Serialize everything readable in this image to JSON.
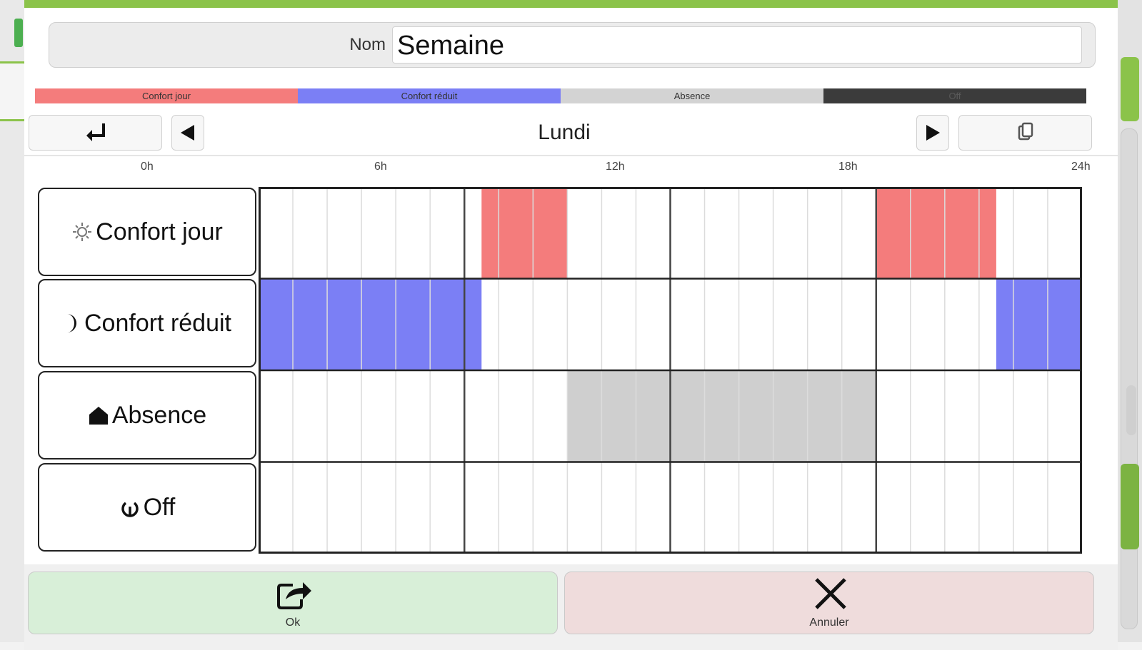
{
  "form": {
    "name_label": "Nom",
    "name_value": "Semaine"
  },
  "legend": [
    {
      "label": "Confort jour",
      "color": "#f47c7c"
    },
    {
      "label": "Confort réduit",
      "color": "#7b7ff5"
    },
    {
      "label": "Absence",
      "color": "#d3d3d3"
    },
    {
      "label": "Off",
      "color": "#3b3b3b"
    }
  ],
  "nav": {
    "day": "Lundi",
    "back_icon": "return-arrow-icon",
    "prev_icon": "left-triangle-icon",
    "next_icon": "right-triangle-icon",
    "copy_icon": "copy-icon"
  },
  "axis": {
    "ticks": [
      "0h",
      "6h",
      "12h",
      "18h",
      "24h"
    ]
  },
  "modes": [
    {
      "label": "Confort jour",
      "icon": "sun-icon",
      "color": "#f47c7c",
      "blocks": [
        [
          6.5,
          9
        ],
        [
          18,
          21.5
        ]
      ]
    },
    {
      "label": "Confort réduit",
      "icon": "moon-icon",
      "color": "#7b7ff5",
      "blocks": [
        [
          0,
          6.5
        ],
        [
          21.5,
          24
        ]
      ]
    },
    {
      "label": "Absence",
      "icon": "house-icon",
      "color": "#cfcfcf",
      "blocks": [
        [
          9,
          18
        ]
      ]
    },
    {
      "label": "Off",
      "icon": "power-icon",
      "color": "#3b3b3b",
      "blocks": []
    }
  ],
  "actions": {
    "ok_label": "Ok",
    "cancel_label": "Annuler",
    "ok_color": "#d8efd8",
    "cancel_color": "#efdcdc"
  }
}
